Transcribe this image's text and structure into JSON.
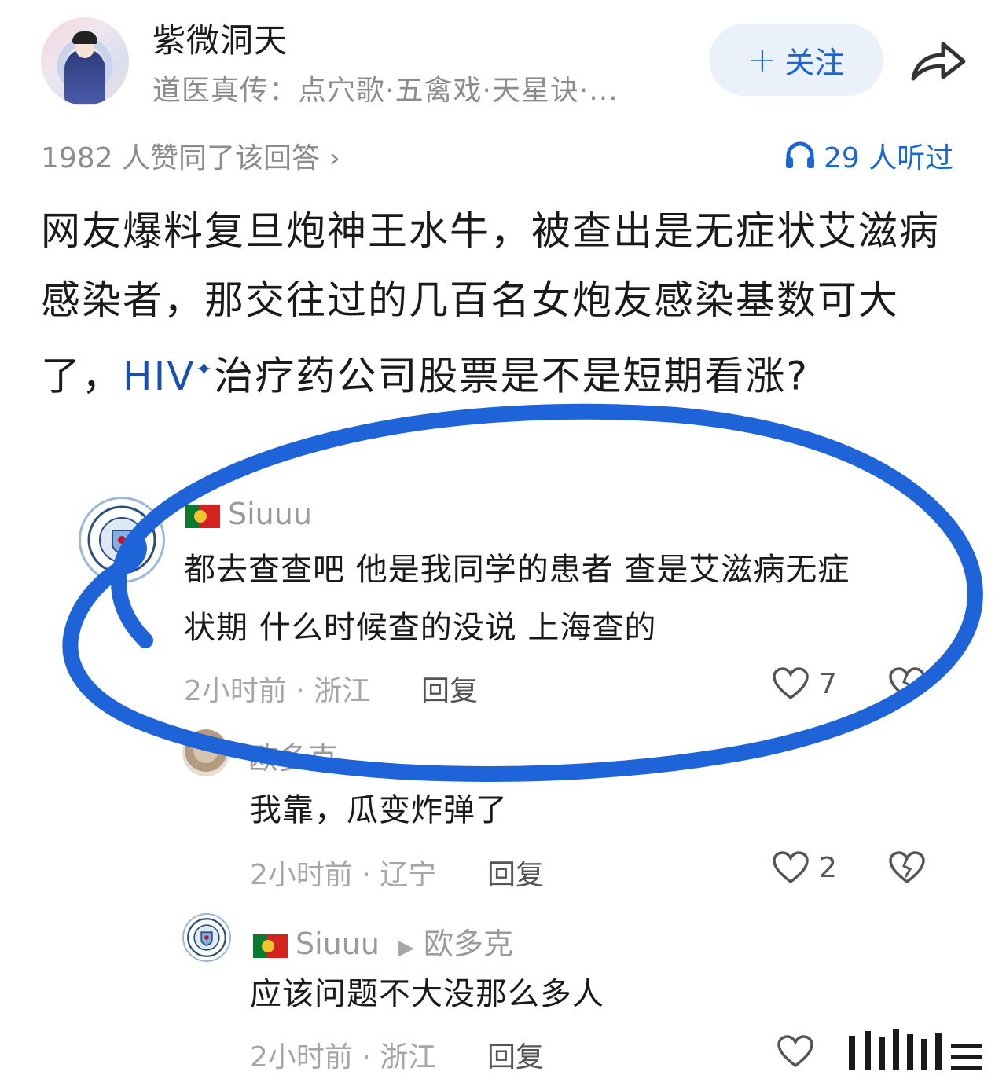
{
  "header": {
    "author_name": "紫微洞天",
    "author_bio": "道医真传：点穴歌·五禽戏·天星诀·...",
    "follow_label": "关注",
    "follow_icon": "plus-icon",
    "share_icon": "share-icon"
  },
  "stats": {
    "upvote_text": "1982 人赞同了该回答 ›",
    "listen_icon": "headphones-icon",
    "listen_text": "29 人听过"
  },
  "question": {
    "text_before": "网友爆料复旦炮神王水牛，被查出是无症状艾滋病感染者，那交往过的几百名女炮友感染基数可大了，",
    "link_text": "HIV",
    "link_sup": "✦",
    "text_after": "治疗药公司股票是不是短期看涨?"
  },
  "comments": [
    {
      "avatar": "manchester-city-badge",
      "flag": "portugal-flag",
      "user": "Siuuu",
      "text_line1": "都去查查吧 他是我同学的患者 查是艾滋病无症",
      "text_line2": "状期 什么时候查的没说 上海查的",
      "meta": "2小时前 · 浙江",
      "reply_label": "回复",
      "likes": "7"
    },
    {
      "avatar": "dog-avatar",
      "user": "欧多克",
      "text": "我靠，瓜变炸弹了",
      "meta": "2小时前 · 辽宁",
      "reply_label": "回复",
      "likes": "2"
    },
    {
      "avatar": "manchester-city-badge",
      "flag": "portugal-flag",
      "user": "Siuuu",
      "reply_to": "欧多克",
      "text": "应该问题不大没那么多人",
      "meta": "2小时前 · 浙江",
      "reply_label": "回复"
    }
  ],
  "colors": {
    "accent": "#1b66d6",
    "annotation": "#1f63d9",
    "muted": "#a6a6a6"
  }
}
